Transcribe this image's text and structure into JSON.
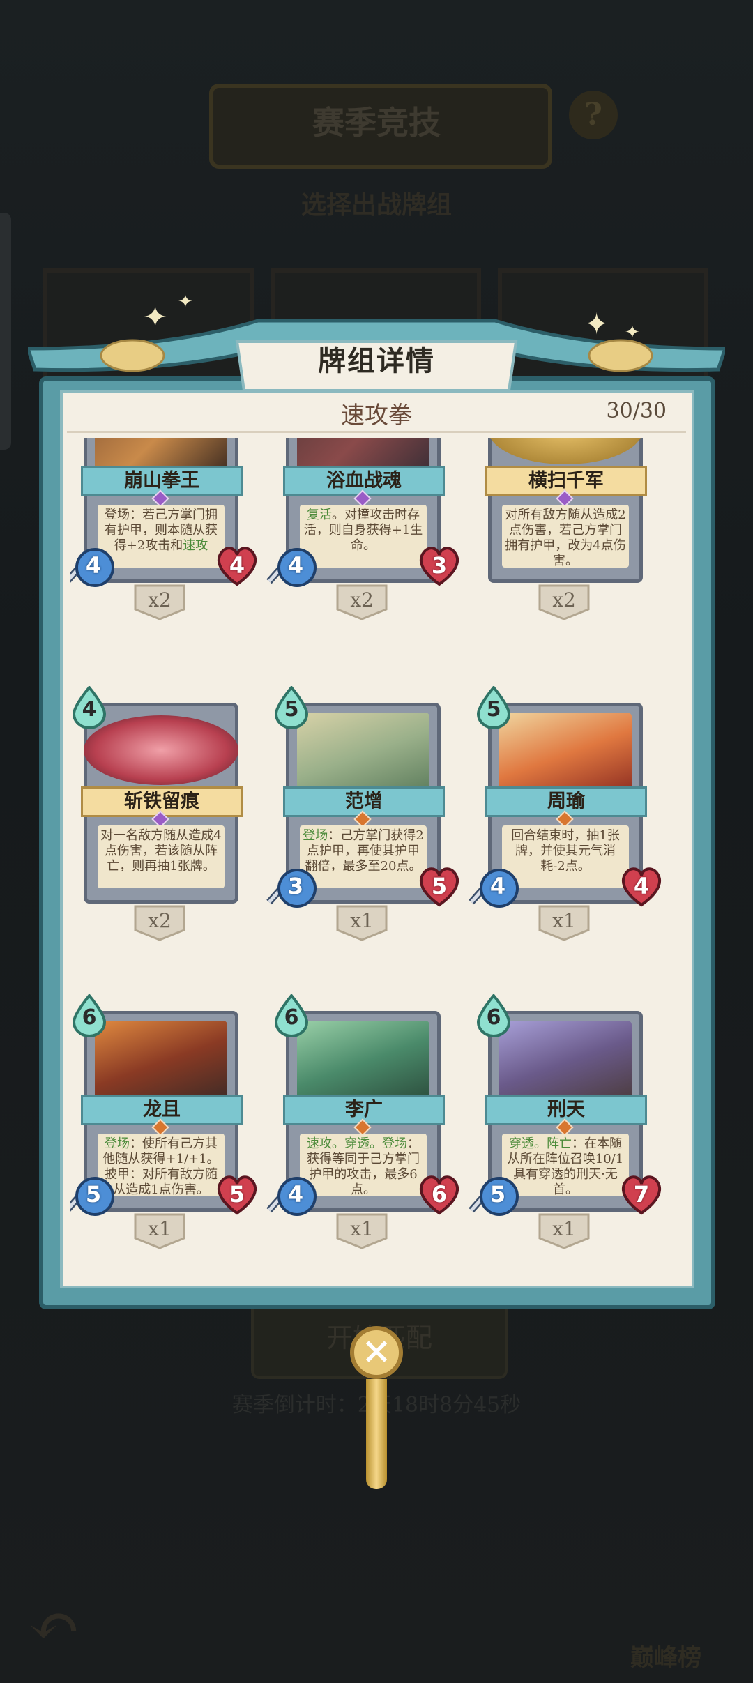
{
  "background": {
    "title": "赛季竞技",
    "help": "?",
    "subtitle": "选择出战牌组",
    "start_label": "开始匹配",
    "timer": "赛季倒计时：2天18时8分45秒",
    "rank_label": "巅峰榜"
  },
  "modal": {
    "title": "牌组详情",
    "deck_name": "速攻拳",
    "deck_count": "30/30",
    "close_icon": "close-icon"
  },
  "colors": {
    "frame_teal": "#5a9ca6",
    "parchment": "#f4efe4",
    "keyword_green": "#4c8b3a",
    "rarity_purple": "#9a5cc6",
    "rarity_orange": "#d8762f"
  },
  "cards": [
    {
      "name": "崩山拳王",
      "cost": "",
      "attack": "4",
      "health": "4",
      "count": "x2",
      "desc_pre": "登场：若己方掌门拥有护甲，则本随从获得+2攻击和",
      "desc_kw": "速攻",
      "desc_post": ""
    },
    {
      "name": "浴血战魂",
      "cost": "",
      "attack": "4",
      "health": "3",
      "count": "x2",
      "desc_pre": "",
      "desc_kw": "复活",
      "desc_post": "。对撞攻击时存活，则自身获得+1生命。"
    },
    {
      "name": "横扫千军",
      "cost": "",
      "attack": "",
      "health": "",
      "count": "x2",
      "desc_pre": "对所有敌方随从造成2点伤害，若己方掌门拥有护甲，改为4点伤害。",
      "desc_kw": "",
      "desc_post": ""
    },
    {
      "name": "斩铁留痕",
      "cost": "4",
      "attack": "",
      "health": "",
      "count": "x2",
      "desc_pre": "对一名敌方随从造成4点伤害，若该随从阵亡，则再抽1张牌。",
      "desc_kw": "",
      "desc_post": ""
    },
    {
      "name": "范增",
      "cost": "5",
      "attack": "3",
      "health": "5",
      "count": "x1",
      "desc_pre": "",
      "desc_kw": "登场",
      "desc_post": "：己方掌门获得2点护甲，再使其护甲翻倍，最多至20点。"
    },
    {
      "name": "周瑜",
      "cost": "5",
      "attack": "4",
      "health": "4",
      "count": "x1",
      "desc_pre": "回合结束时，抽1张牌，并使其元气消耗-2点。",
      "desc_kw": "",
      "desc_post": ""
    },
    {
      "name": "龙且",
      "cost": "6",
      "attack": "5",
      "health": "5",
      "count": "x1",
      "desc_pre": "",
      "desc_kw": "登场",
      "desc_post": "：使所有己方其他随从获得+1/+1。披甲：对所有敌方随从造成1点伤害。"
    },
    {
      "name": "李广",
      "cost": "6",
      "attack": "4",
      "health": "6",
      "count": "x1",
      "desc_pre": "",
      "desc_kw": "速攻。穿透。登场",
      "desc_post": "：获得等同于己方掌门护甲的攻击，最多6点。"
    },
    {
      "name": "刑天",
      "cost": "6",
      "attack": "5",
      "health": "7",
      "count": "x1",
      "desc_pre": "",
      "desc_kw": "穿透。阵亡",
      "desc_post": "：在本随从所在阵位召唤10/1具有穿透的刑天·无首。"
    }
  ]
}
